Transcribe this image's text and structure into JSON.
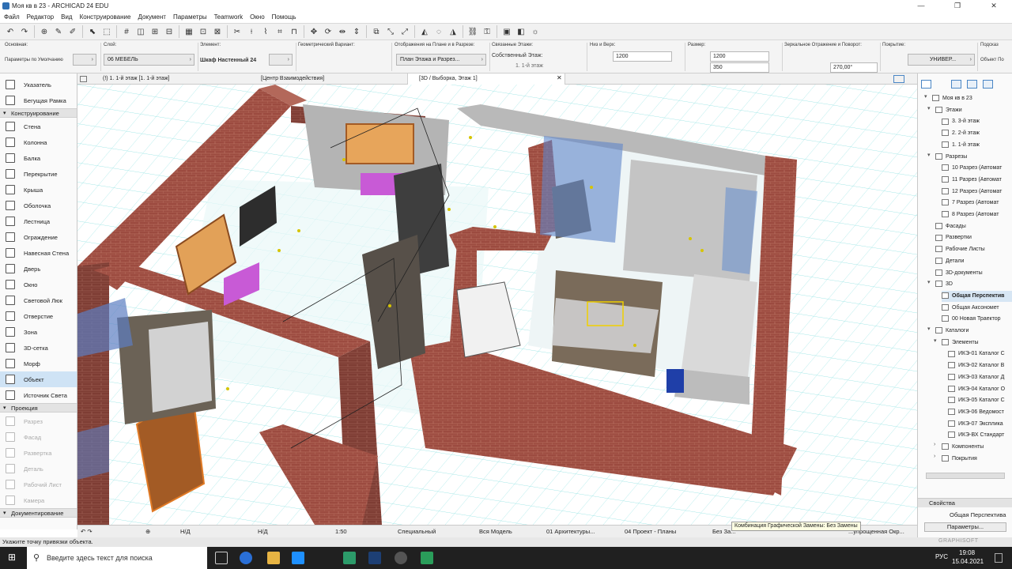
{
  "window": {
    "title": "Моя кв в 23 - ARCHICAD 24 EDU",
    "icon": "archicad-icon"
  },
  "menu": [
    "Файл",
    "Редактор",
    "Вид",
    "Конструирование",
    "Документ",
    "Параметры",
    "Teamwork",
    "Окно",
    "Помощь"
  ],
  "info_box": {
    "main_label": "Основная:",
    "main_value": "Параметры по Умолчанию",
    "layer_label": "Слой:",
    "layer_value": "06 МЕБЕЛЬ",
    "element_label": "Элемент:",
    "element_value": "Шкаф Настенный 24",
    "geometry_label": "Геометрический Вариант:",
    "display_label": "Отображения на Плане и в Разрезе:",
    "display_value": "План Этажа и Разрез...",
    "linked_label": "Связанные Этажи:",
    "linked_value": "Собственный Этаж:",
    "linked_floor": "1. 1-й этаж",
    "bottom_top_label": "Низ и Верх:",
    "bottom_top_value": "1200",
    "size_label": "Размер:",
    "size_w": "1200",
    "size_h": "350",
    "mirror_label": "Зеркальное Отражение и Поворот:",
    "rotation": "270,00°",
    "cover_label": "Покрытие:",
    "cover_value": "УНИВЕР...",
    "tips_label": "Подсказ",
    "tips_value": "Объект По"
  },
  "toolbox": {
    "items_top": [
      "Указатель",
      "Бегущая Рамка"
    ],
    "section_construct": "Конструирование",
    "construct": [
      "Стена",
      "Колонна",
      "Балка",
      "Перекрытие",
      "Крыша",
      "Оболочка",
      "Лестница",
      "Ограждение",
      "Навесная Стена",
      "Дверь",
      "Окно",
      "Световой Люк",
      "Отверстие",
      "Зона",
      "3D-сетка",
      "Морф",
      "Объект",
      "Источник Света"
    ],
    "selected": "Объект",
    "section_projection": "Проекция",
    "projection": [
      "Разрез",
      "Фасад",
      "Развертка",
      "Деталь",
      "Рабочий Лист",
      "Камера"
    ],
    "section_doc": "Документирование"
  },
  "tabs": [
    {
      "label": "(!) 1. 1-й этаж [1. 1-й этаж]",
      "active": false
    },
    {
      "label": "[Центр Взаимодействия]",
      "active": false
    },
    {
      "label": "[3D / Выборка, Этаж 1]",
      "active": true
    }
  ],
  "navigator": {
    "project": "Моя кв в 23",
    "floors_label": "Этажи",
    "floors": [
      "3. 3-й этаж",
      "2. 2-й этаж",
      "1. 1-й этаж"
    ],
    "sections_label": "Разрезы",
    "sections": [
      "10 Разрез (Автомат",
      "11 Разрез (Автомат",
      "12 Разрез (Автомат",
      "7 Разрез (Автомат",
      "8 Разрез (Автомат"
    ],
    "other": [
      "Фасады",
      "Развертки",
      "Рабочие Листы",
      "Детали",
      "3D-документы"
    ],
    "threed_label": "3D",
    "threed": [
      "Общая Перспектив",
      "Общая Аксономет",
      "00 Новая Траектор"
    ],
    "catalogs_label": "Каталоги",
    "elements_label": "Элементы",
    "elements": [
      "ИКЭ-01 Каталог С",
      "ИКЭ-02 Каталог В",
      "ИКЭ-03 Каталог Д",
      "ИКЭ-04 Каталог О",
      "ИКЭ-05 Каталог С",
      "ИКЭ-06 Ведомост",
      "ИКЭ-07 Экспликa",
      "ИКЭ-ВХ Стандарт"
    ],
    "components": "Компоненты",
    "covers": "Покрытия",
    "properties_label": "Свойства",
    "properties_value": "Общая Перспектива",
    "params_button": "Параметры...",
    "brand": "GRAPHISOFT"
  },
  "bottom_bar": {
    "na1": "Н/Д",
    "na2": "Н/Д",
    "scale": "1:50",
    "mode": "Специальный",
    "model": "Вся Модель",
    "layers": "01 Архитектуры...",
    "pen": "04 Проект - Планы",
    "override": "Без За...",
    "simplified": "...упрощенная Окр..."
  },
  "tooltip": "Комбинация Графической Замены: Без Замены",
  "status": "Укажите точку привязки объекта.",
  "taskbar": {
    "search_placeholder": "Введите здесь текст для поиска",
    "lang": "РУС",
    "time": "19:08",
    "date": "15.04.2021"
  },
  "colors": {
    "brick": "#9a4a3e",
    "brick_dark": "#7a3a31",
    "grid": "#7fdede",
    "floor": "#e9f7f7",
    "selection": "#cfe3f5"
  }
}
